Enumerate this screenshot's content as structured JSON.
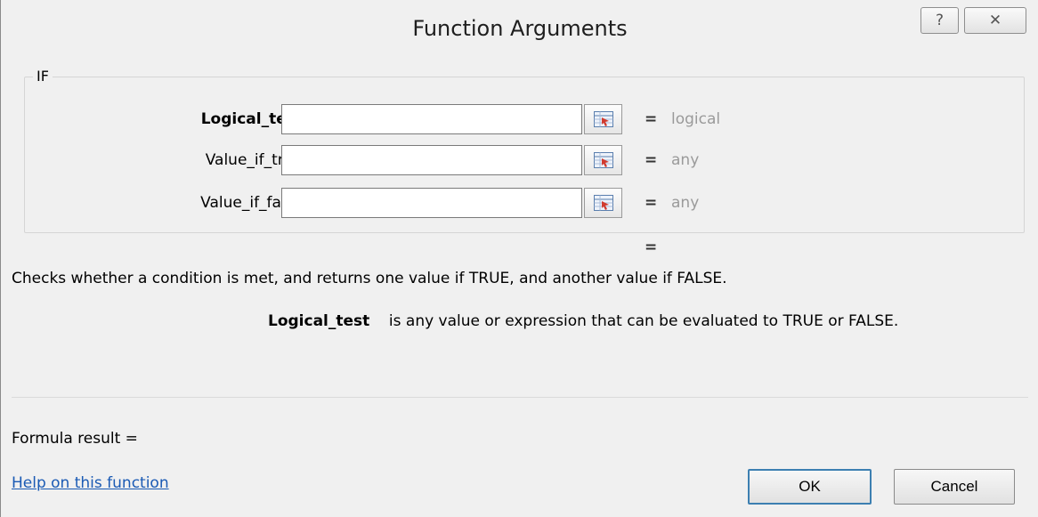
{
  "window": {
    "title": "Function Arguments",
    "help_glyph": "?",
    "close_glyph": "✕"
  },
  "group": {
    "legend": "IF"
  },
  "arguments": [
    {
      "label": "Logical_test",
      "value": "",
      "equals": "=",
      "result": "logical",
      "icon": "collapse-dialog-icon"
    },
    {
      "label": "Value_if_true",
      "value": "",
      "equals": "=",
      "result": "any",
      "icon": "collapse-dialog-icon"
    },
    {
      "label": "Value_if_false",
      "value": "",
      "equals": "=",
      "result": "any",
      "icon": "collapse-dialog-icon"
    }
  ],
  "function_result_equals": "=",
  "description": "Checks whether a condition is met, and returns one value if TRUE, and another value if FALSE.",
  "argument_help": {
    "name": "Logical_test",
    "text": "is any value or expression that can be evaluated to TRUE or FALSE."
  },
  "formula_result": "Formula result =",
  "help_link": "Help on this function",
  "buttons": {
    "ok": "OK",
    "cancel": "Cancel"
  },
  "colors": {
    "dialog_bg": "#f0f0f0",
    "link": "#1a5ab4",
    "muted_result": "#9a9a9a",
    "default_button_border": "#3c7fb1"
  }
}
